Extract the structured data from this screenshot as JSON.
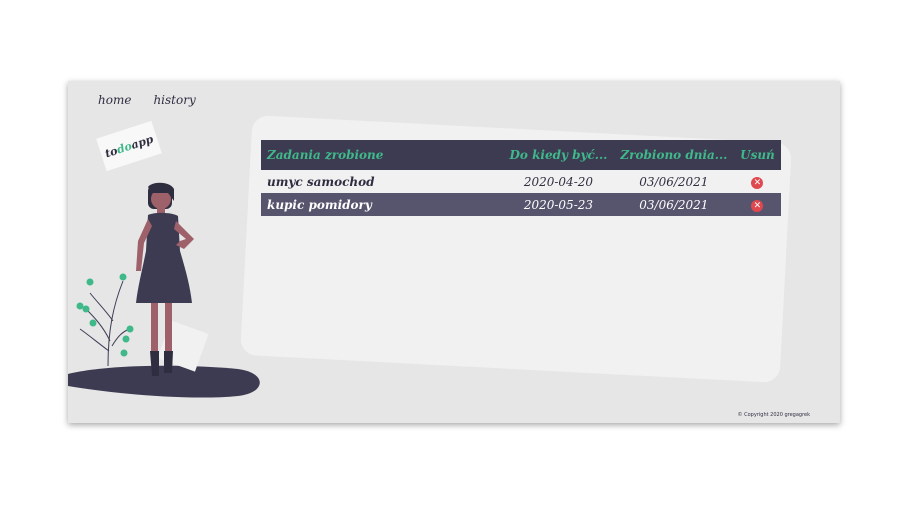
{
  "nav": {
    "home_label": "home",
    "history_label": "history"
  },
  "logo": {
    "part1": "to",
    "part2": "do",
    "part3": "app"
  },
  "table": {
    "headers": [
      "Zadania zrobione",
      "Do kiedy być...",
      "Zrobiono dnia...",
      "Usuń"
    ],
    "rows": [
      {
        "task": "umyc samochod",
        "due": "2020-04-20",
        "done": "03/06/2021",
        "delete": "✕"
      },
      {
        "task": "kupic pomidory",
        "due": "2020-05-23",
        "done": "03/06/2021",
        "delete": "✕"
      }
    ]
  },
  "footer": {
    "copyright": "© Copyright 2020 gregagrek"
  },
  "colors": {
    "accent": "#3fb98a",
    "header_bg": "#3d3b52",
    "delete": "#e0484f"
  }
}
